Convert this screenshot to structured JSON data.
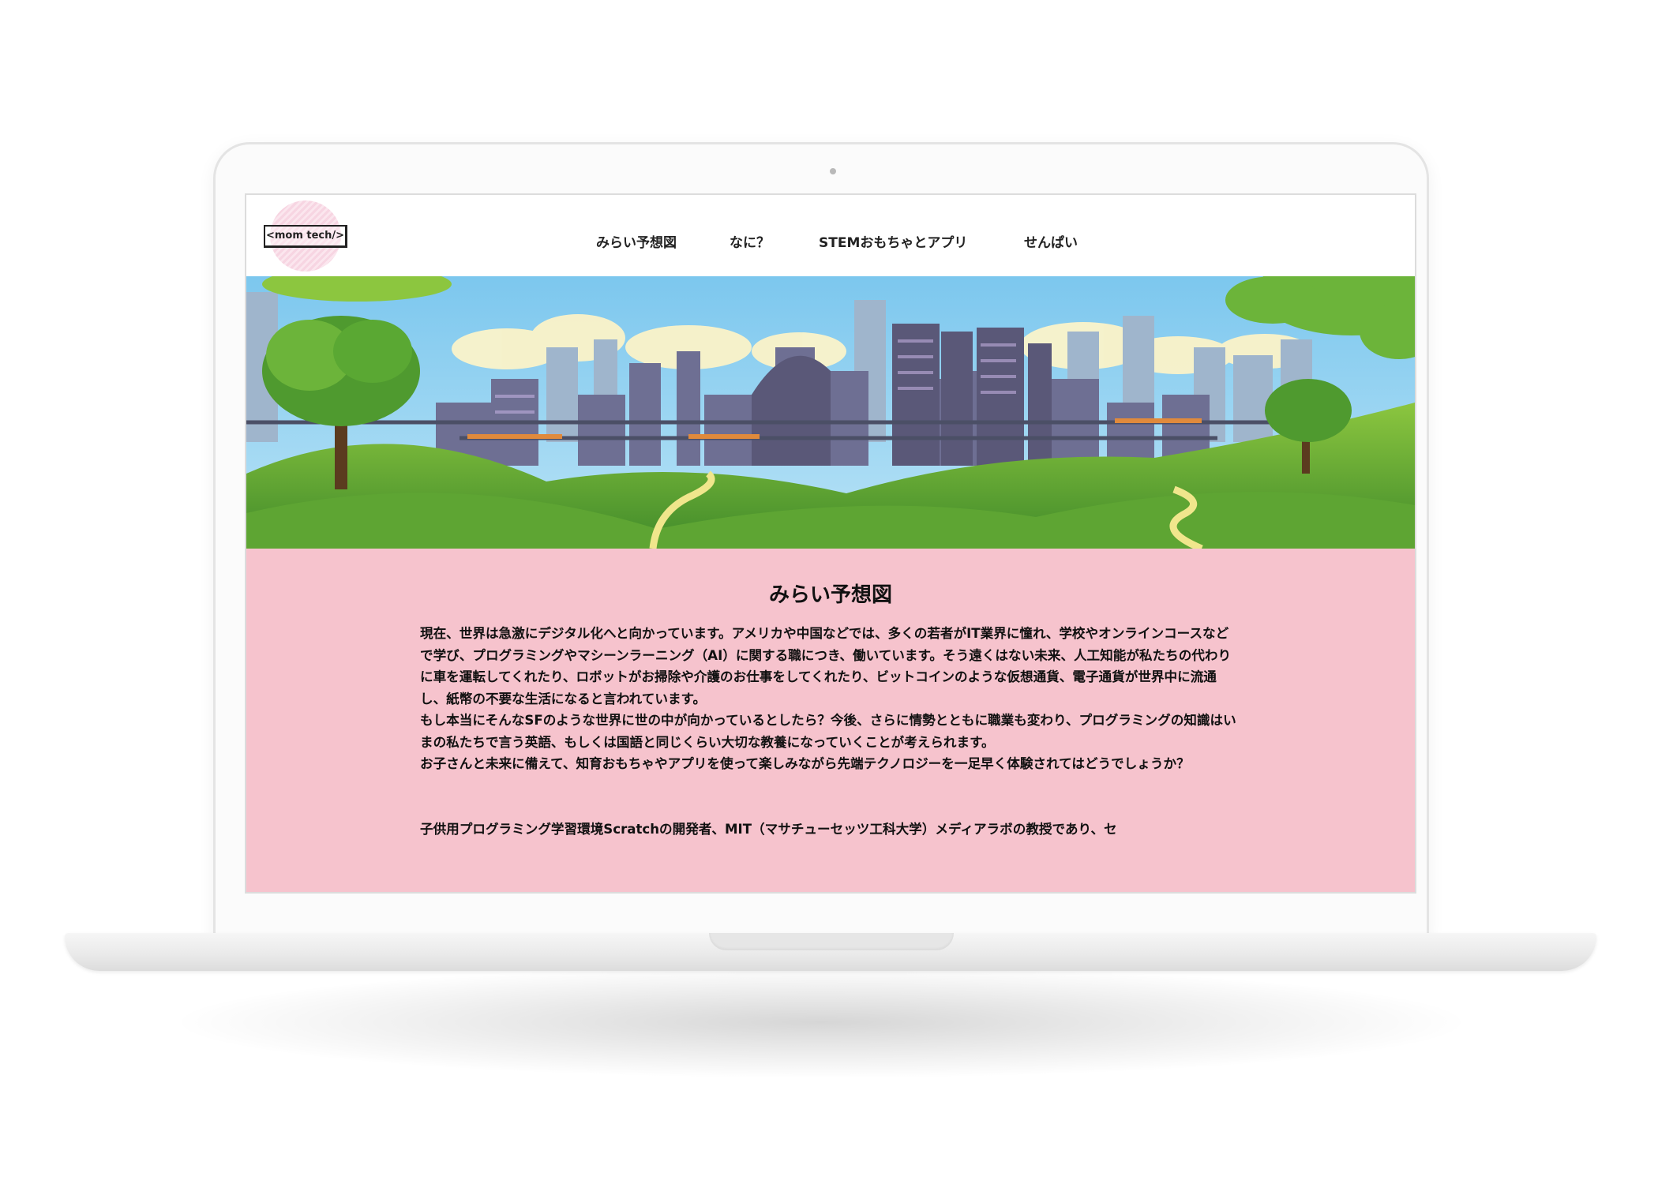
{
  "logo": {
    "text": "<mom tech/>"
  },
  "nav": {
    "items": [
      {
        "label": "みらい予想図"
      },
      {
        "label": "なに？"
      },
      {
        "label": "STEMおもちゃとアプリ"
      },
      {
        "label": "せんぱい"
      }
    ]
  },
  "main": {
    "title": "みらい予想図",
    "paragraphs": [
      "現在、世界は急激にデジタル化へと向かっています。アメリカや中国などでは、多くの若者がIT業界に憧れ、学校やオンラインコースなどで学び、プログラミングやマシーンラーニング（AI）に関する職につき、働いています。そう遠くはない未来、人工知能が私たちの代わりに車を運転してくれたり、ロボットがお掃除や介護のお仕事をしてくれたり、ビットコインのような仮想通貨、電子通貨が世界中に流通し、紙幣の不要な生活になると言われています。",
      "もし本当にそんなSFのような世界に世の中が向かっているとしたら？今後、さらに情勢とともに職業も変わり、プログラミングの知識はいまの私たちで言う英語、もしくは国語と同じくらい大切な教養になっていくことが考えられます。",
      "お子さんと未来に備えて、知育おもちゃやアプリを使って楽しみながら先端テクノロジーを一足早く体験されてはどうでしょうか？",
      "子供用プログラミング学習環境Scratchの開発者、MIT（マサチューセッツ工科大学）メディアラボの教授であり、セ"
    ]
  },
  "colors": {
    "content_bg": "#f6c3cd",
    "logo_pink": "#f7d5e2",
    "sky": "#8fd0f0",
    "grass": "#6fb23a"
  }
}
